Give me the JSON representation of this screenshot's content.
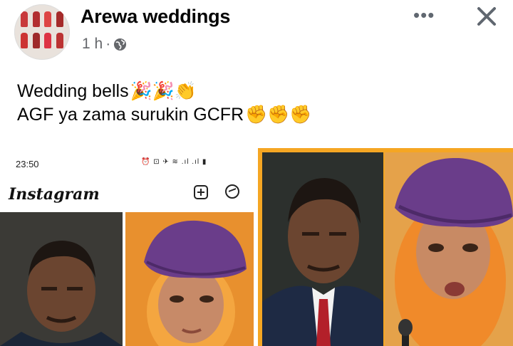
{
  "post": {
    "page_name": "Arewa weddings",
    "time": "1 h",
    "separator": "·",
    "more_label": "•••",
    "lines": [
      {
        "text": "Wedding bells",
        "emojis": "🎉🎉👏"
      },
      {
        "text": "AGF ya zama surukin GCFR",
        "emojis": "✊✊✊"
      }
    ]
  },
  "screenshot": {
    "status_time": "23:50",
    "app_name": "Instagram",
    "app_chevron": "⌄"
  },
  "icons": {
    "globe": "globe-icon",
    "close": "close-icon",
    "more": "more-icon",
    "add": "add-post-icon",
    "messenger": "messenger-icon"
  },
  "colors": {
    "accent_orange": "#f5a623",
    "turban_purple": "#6a3d8a",
    "meta_gray": "#65676b"
  }
}
